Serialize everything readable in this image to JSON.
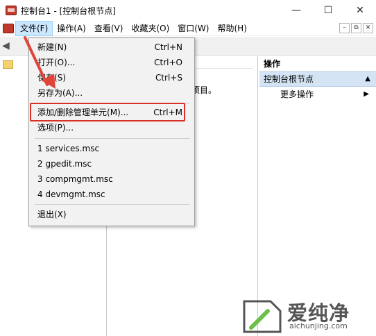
{
  "window": {
    "title": "控制台1 - [控制台根节点]",
    "controls": {
      "minimize": "—",
      "maximize": "☐",
      "close": "✕"
    }
  },
  "menubar": {
    "items": [
      "文件(F)",
      "操作(A)",
      "查看(V)",
      "收藏夹(O)",
      "窗口(W)",
      "帮助(H)"
    ],
    "active_index": 0,
    "mdi_controls": [
      "–",
      "⧉",
      "✕"
    ]
  },
  "center": {
    "description_fragment": "项目。"
  },
  "actions": {
    "header": "操作",
    "section": "控制台根节点",
    "section_icon": "collapse-triangle-icon",
    "more": "更多操作"
  },
  "file_menu": {
    "items": [
      {
        "label": "新建(N)",
        "shortcut": "Ctrl+N"
      },
      {
        "label": "打开(O)...",
        "shortcut": "Ctrl+O"
      },
      {
        "label": "保存(S)",
        "shortcut": "Ctrl+S"
      },
      {
        "label": "另存为(A)...",
        "shortcut": ""
      },
      {
        "label": "添加/删除管理单元(M)...",
        "shortcut": "Ctrl+M"
      },
      {
        "label": "选项(P)...",
        "shortcut": ""
      },
      {
        "label": "1 services.msc",
        "shortcut": ""
      },
      {
        "label": "2 gpedit.msc",
        "shortcut": ""
      },
      {
        "label": "3 compmgmt.msc",
        "shortcut": ""
      },
      {
        "label": "4 devmgmt.msc",
        "shortcut": ""
      },
      {
        "label": "退出(X)",
        "shortcut": ""
      }
    ],
    "highlighted_item": "添加/删除管理单元(M)..."
  },
  "annotation": {
    "arrow_color": "#e0443a",
    "box_color": "#d93025"
  },
  "watermark": {
    "text": "爱纯净",
    "sub": "aichunjing.com"
  }
}
